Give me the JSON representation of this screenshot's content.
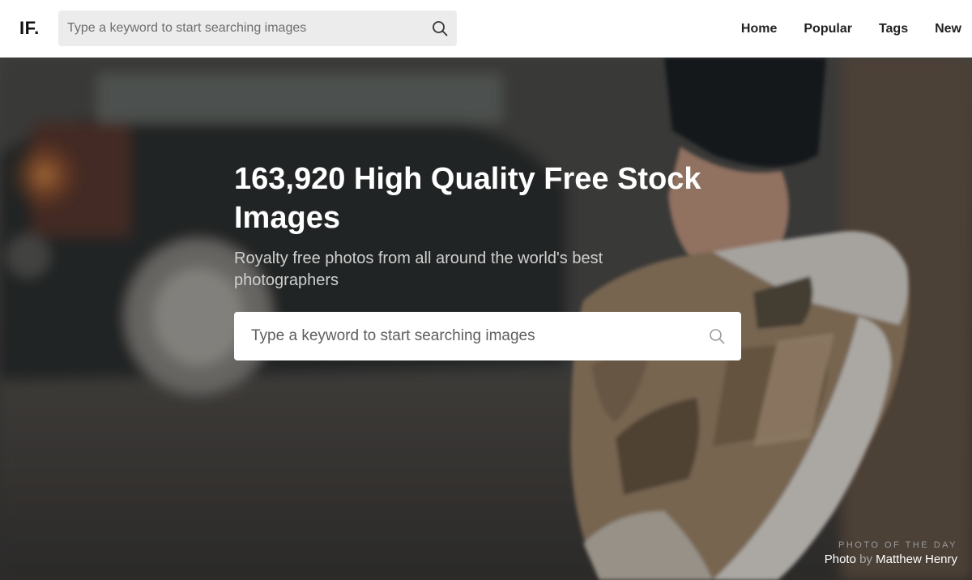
{
  "header": {
    "logo": "IF.",
    "search": {
      "placeholder": "Type a keyword to start searching images"
    },
    "nav": [
      {
        "label": "Home"
      },
      {
        "label": "Popular"
      },
      {
        "label": "Tags"
      },
      {
        "label": "New"
      }
    ]
  },
  "hero": {
    "title": "163,920 High Quality Free Stock Images",
    "subtitle": "Royalty free photos from all around the world's best photographers",
    "search": {
      "placeholder": "Type a keyword to start searching images"
    },
    "photo_of_the_day": {
      "label": "PHOTO OF THE DAY",
      "photo_word": "Photo",
      "by_word": "by",
      "photographer": "Matthew Henry"
    }
  },
  "colors": {
    "accent_text": "#ffffff",
    "nav_text": "#222222",
    "search_bg": "#ececec"
  }
}
